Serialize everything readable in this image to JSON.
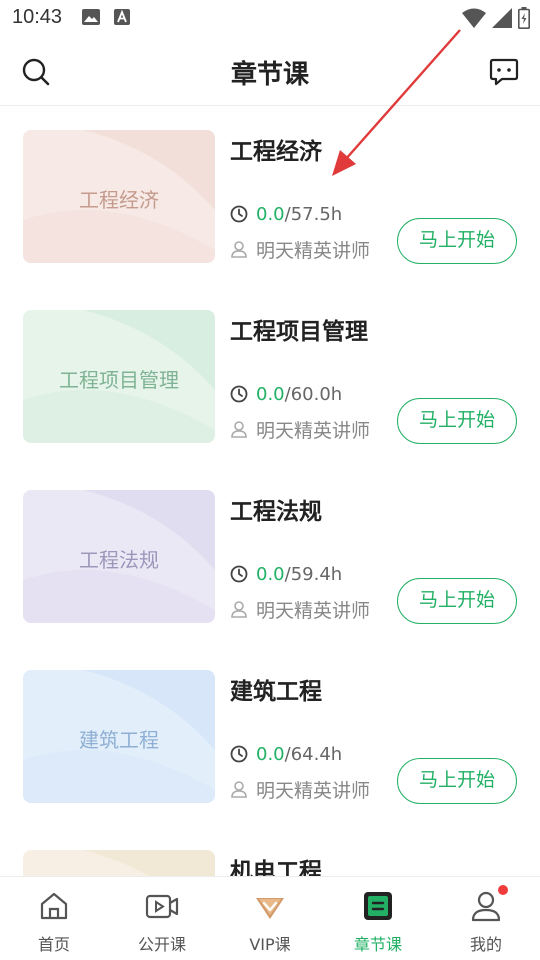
{
  "status_bar": {
    "time": "10:43"
  },
  "header": {
    "title": "章节课"
  },
  "courses": [
    {
      "title": "工程经济",
      "thumb_label": "工程经济",
      "progress": "0.0",
      "total": "/57.5h",
      "teacher": "明天精英讲师",
      "button": "马上开始",
      "theme": {
        "bg1": "#f7e9e5",
        "bg2": "#efd9d1",
        "text": "#c49b8d"
      }
    },
    {
      "title": "工程项目管理",
      "thumb_label": "工程项目管理",
      "progress": "0.0",
      "total": "/60.0h",
      "teacher": "明天精英讲师",
      "button": "马上开始",
      "theme": {
        "bg1": "#e6f4ea",
        "bg2": "#cfe9d8",
        "text": "#7fb394"
      }
    },
    {
      "title": "工程法规",
      "thumb_label": "工程法规",
      "progress": "0.0",
      "total": "/59.4h",
      "teacher": "明天精英讲师",
      "button": "马上开始",
      "theme": {
        "bg1": "#ebe8f5",
        "bg2": "#dad5ee",
        "text": "#9b97bb"
      }
    },
    {
      "title": "建筑工程",
      "thumb_label": "建筑工程",
      "progress": "0.0",
      "total": "/64.4h",
      "teacher": "明天精英讲师",
      "button": "马上开始",
      "theme": {
        "bg1": "#e3eefb",
        "bg2": "#cfe1f6",
        "text": "#8fb0d4"
      }
    },
    {
      "title": "机电工程",
      "thumb_label": "",
      "progress": "",
      "total": "",
      "teacher": "",
      "button": "",
      "theme": {
        "bg1": "#f7efe3",
        "bg2": "#efe2cd",
        "text": "#c9ad84"
      }
    }
  ],
  "bottom_nav": [
    {
      "label": "首页",
      "icon": "home-icon",
      "active": false
    },
    {
      "label": "公开课",
      "icon": "video-icon",
      "active": false
    },
    {
      "label": "VIP课",
      "icon": "vip-icon",
      "active": false
    },
    {
      "label": "章节课",
      "icon": "chapter-icon",
      "active": true
    },
    {
      "label": "我的",
      "icon": "user-icon",
      "active": false,
      "badge_dot": true
    }
  ],
  "colors": {
    "accent": "#22b064",
    "annotation": "#e03a3a",
    "badge": "#f03c3c"
  }
}
